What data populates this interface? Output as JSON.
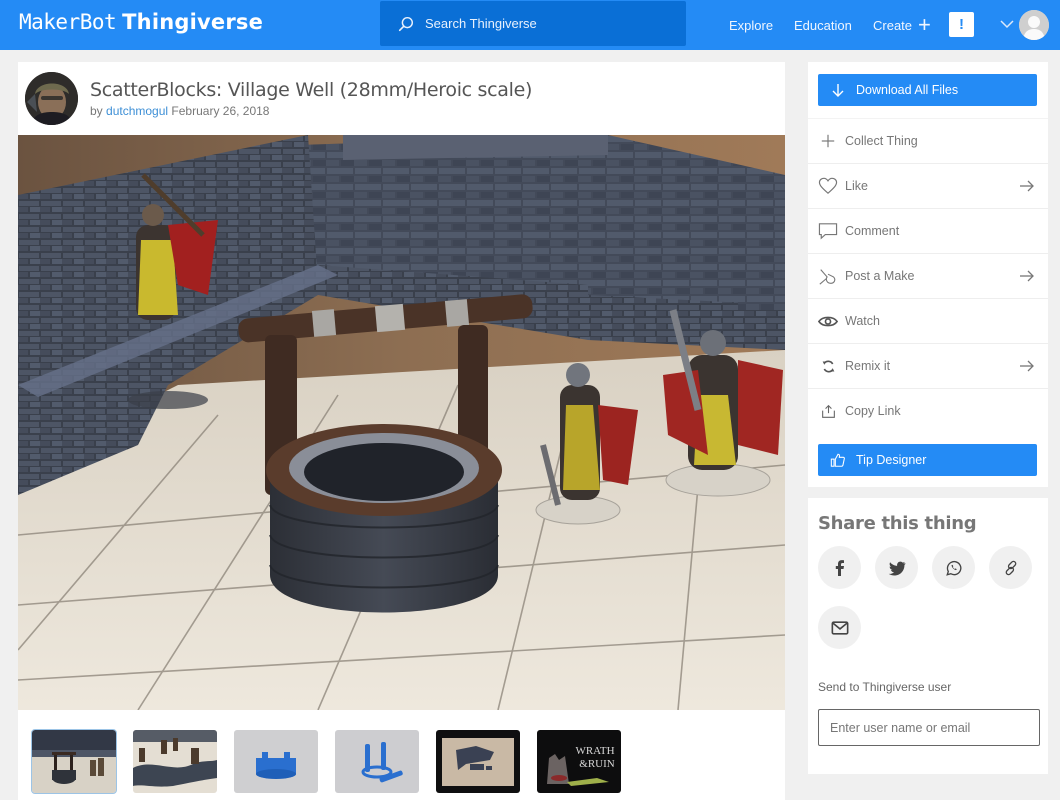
{
  "header": {
    "logo_maker": "MakerBot",
    "logo_thingiverse": "Thingiverse",
    "search_placeholder": "Search Thingiverse",
    "nav": {
      "explore": "Explore",
      "education": "Education",
      "create": "Create",
      "create_plus": "+"
    },
    "notification_glyph": "!",
    "brand_color": "#248bf5"
  },
  "thing": {
    "title": "ScatterBlocks: Village Well (28mm/Heroic scale)",
    "by_prefix": "by",
    "author": "dutchmogul",
    "date": "February 26, 2018"
  },
  "gallery": {
    "active_index": 0,
    "thumbnails": [
      {
        "subject": "well-with-miniatures-photo"
      },
      {
        "subject": "miniatures-on-wall-photo"
      },
      {
        "subject": "well-base-render"
      },
      {
        "subject": "well-posts-render"
      },
      {
        "subject": "dungeon-tiles-photo"
      },
      {
        "subject": "wrath-and-ruin-poster",
        "caption_line1": "WRATH",
        "caption_line2": "&RUIN"
      }
    ]
  },
  "sidebar": {
    "download_label": "Download All Files",
    "actions": [
      {
        "label": "Collect Thing",
        "icon": "plus-icon",
        "has_arrow": false
      },
      {
        "label": "Like",
        "icon": "heart-icon",
        "has_arrow": true
      },
      {
        "label": "Comment",
        "icon": "comment-icon",
        "has_arrow": false
      },
      {
        "label": "Post a Make",
        "icon": "make-icon",
        "has_arrow": true
      },
      {
        "label": "Watch",
        "icon": "eye-icon",
        "has_arrow": false
      },
      {
        "label": "Remix it",
        "icon": "remix-icon",
        "has_arrow": true
      },
      {
        "label": "Copy Link",
        "icon": "share-icon",
        "has_arrow": false
      }
    ],
    "tip_label": "Tip Designer"
  },
  "share": {
    "title": "Share this thing",
    "buttons": [
      "facebook",
      "twitter",
      "whatsapp",
      "link",
      "email"
    ],
    "send_label": "Send to Thingiverse user",
    "send_placeholder": "Enter user name or email"
  }
}
